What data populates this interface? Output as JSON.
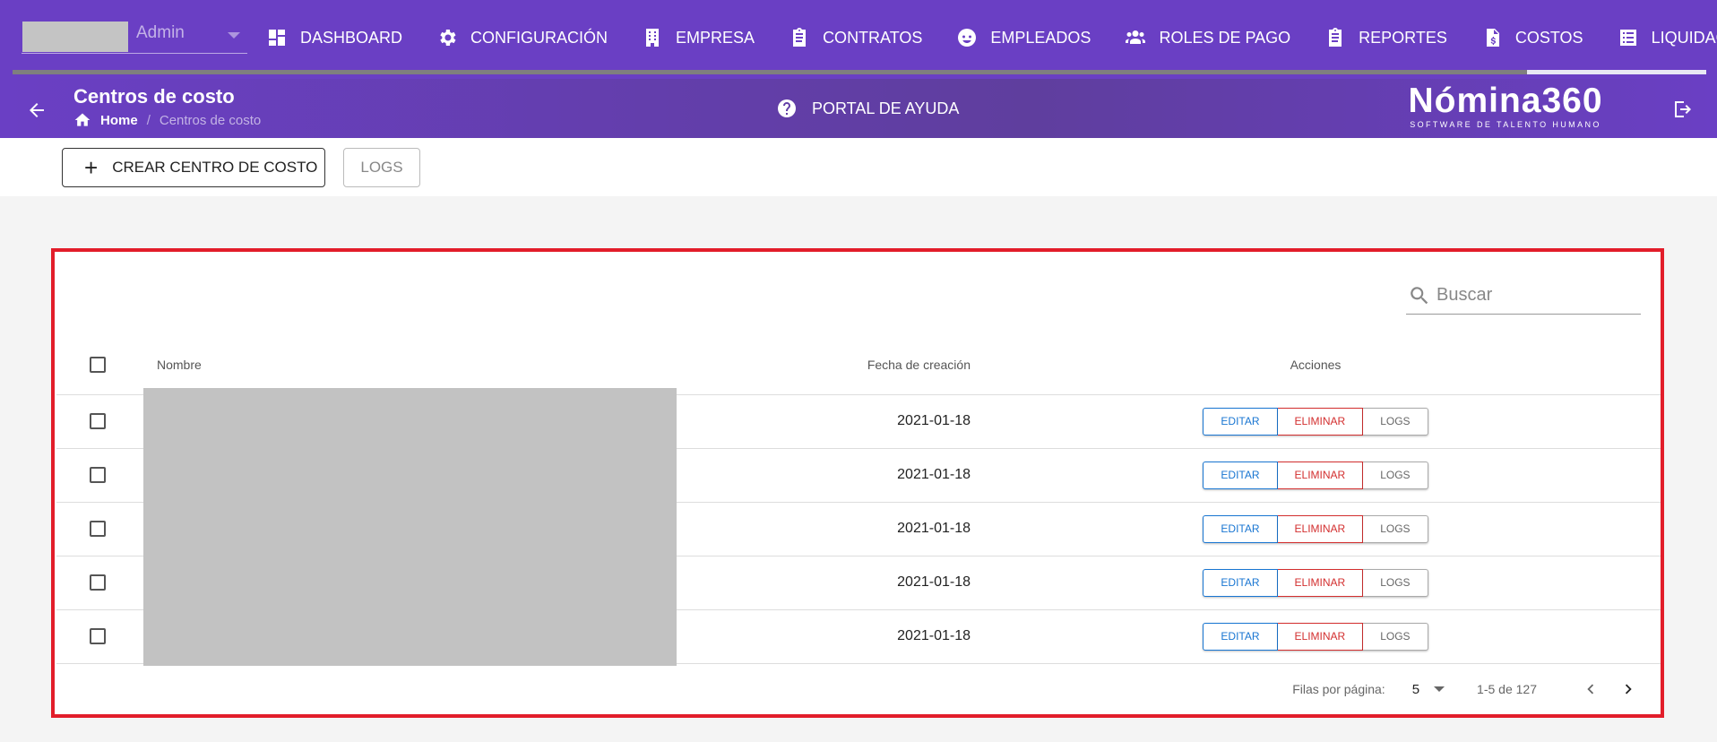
{
  "company": {
    "name": "Admin"
  },
  "nav": {
    "items": [
      {
        "label": "DASHBOARD",
        "icon": "dashboard-icon"
      },
      {
        "label": "CONFIGURACIÓN",
        "icon": "gear-icon"
      },
      {
        "label": "EMPRESA",
        "icon": "building-icon"
      },
      {
        "label": "CONTRATOS",
        "icon": "clipboard-icon"
      },
      {
        "label": "EMPLEADOS",
        "icon": "face-icon"
      },
      {
        "label": "ROLES DE PAGO",
        "icon": "people-icon"
      },
      {
        "label": "REPORTES",
        "icon": "clipboard-icon"
      },
      {
        "label": "COSTOS",
        "icon": "invoice-dollar-icon"
      },
      {
        "label": "LIQUIDACIONES",
        "icon": "list-icon"
      }
    ]
  },
  "header": {
    "title": "Centros de costo",
    "breadcrumb": {
      "home": "Home",
      "separator": "/",
      "current": "Centros de costo"
    },
    "help_label": "PORTAL DE AYUDA",
    "brand_name": "Nómina360",
    "brand_tagline": "SOFTWARE DE TALENTO HUMANO"
  },
  "toolbar": {
    "create_label": "CREAR CENTRO DE COSTO",
    "logs_label": "LOGS"
  },
  "table": {
    "search_placeholder": "Buscar",
    "columns": {
      "name": "Nombre",
      "date": "Fecha de creación",
      "actions": "Acciones"
    },
    "rows": [
      {
        "name": "",
        "date": "2021-01-18"
      },
      {
        "name": "",
        "date": "2021-01-18"
      },
      {
        "name": "",
        "date": "2021-01-18"
      },
      {
        "name": "",
        "date": "2021-01-18"
      },
      {
        "name": "",
        "date": "2021-01-18"
      }
    ],
    "actions": {
      "edit": "EDITAR",
      "delete": "ELIMINAR",
      "logs": "LOGS"
    }
  },
  "pagination": {
    "rows_per_page_label": "Filas por página:",
    "rows_per_page": "5",
    "range": "1-5 de 127"
  },
  "colors": {
    "primary": "#6a3fc4",
    "highlight_border": "#e21d2a",
    "edit": "#1976d2",
    "delete": "#d32f2f"
  }
}
